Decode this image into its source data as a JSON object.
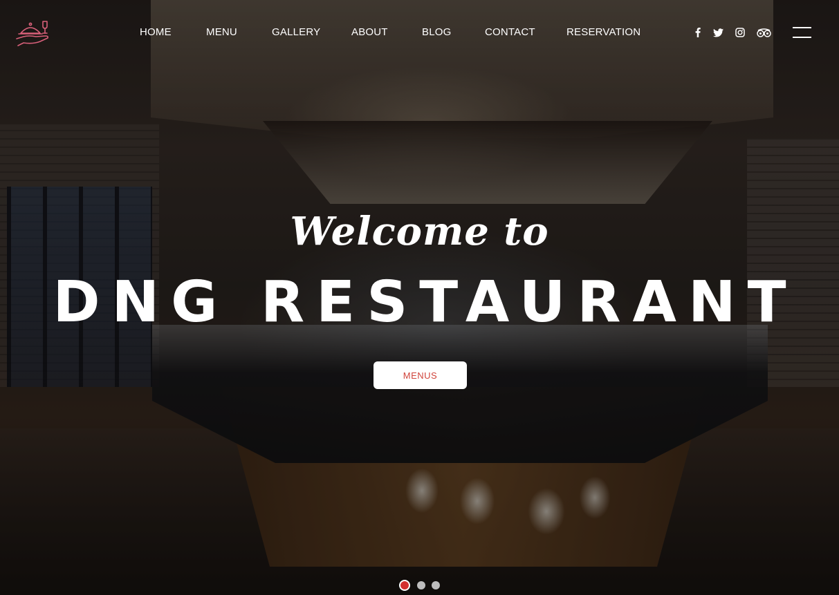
{
  "header": {
    "logo_alt": "DNG Restaurant logo",
    "nav": [
      {
        "label": "HOME"
      },
      {
        "label": "MENU"
      },
      {
        "label": "GALLERY"
      },
      {
        "label": "ABOUT"
      },
      {
        "label": "BLOG"
      },
      {
        "label": "CONTACT"
      },
      {
        "label": "RESERVATION"
      }
    ],
    "social": [
      {
        "icon": "facebook-icon"
      },
      {
        "icon": "twitter-icon"
      },
      {
        "icon": "instagram-icon"
      },
      {
        "icon": "tripadvisor-icon"
      }
    ],
    "menu_icon": "hamburger-menu-icon"
  },
  "hero": {
    "welcome": "Welcome to",
    "title": "DNG RESTAURANT",
    "button_label": "MENUS"
  },
  "slider": {
    "slides": 3,
    "active": 1
  },
  "colors": {
    "accent": "#d0433a",
    "text": "#ffffff",
    "logo": "#d9607a"
  }
}
